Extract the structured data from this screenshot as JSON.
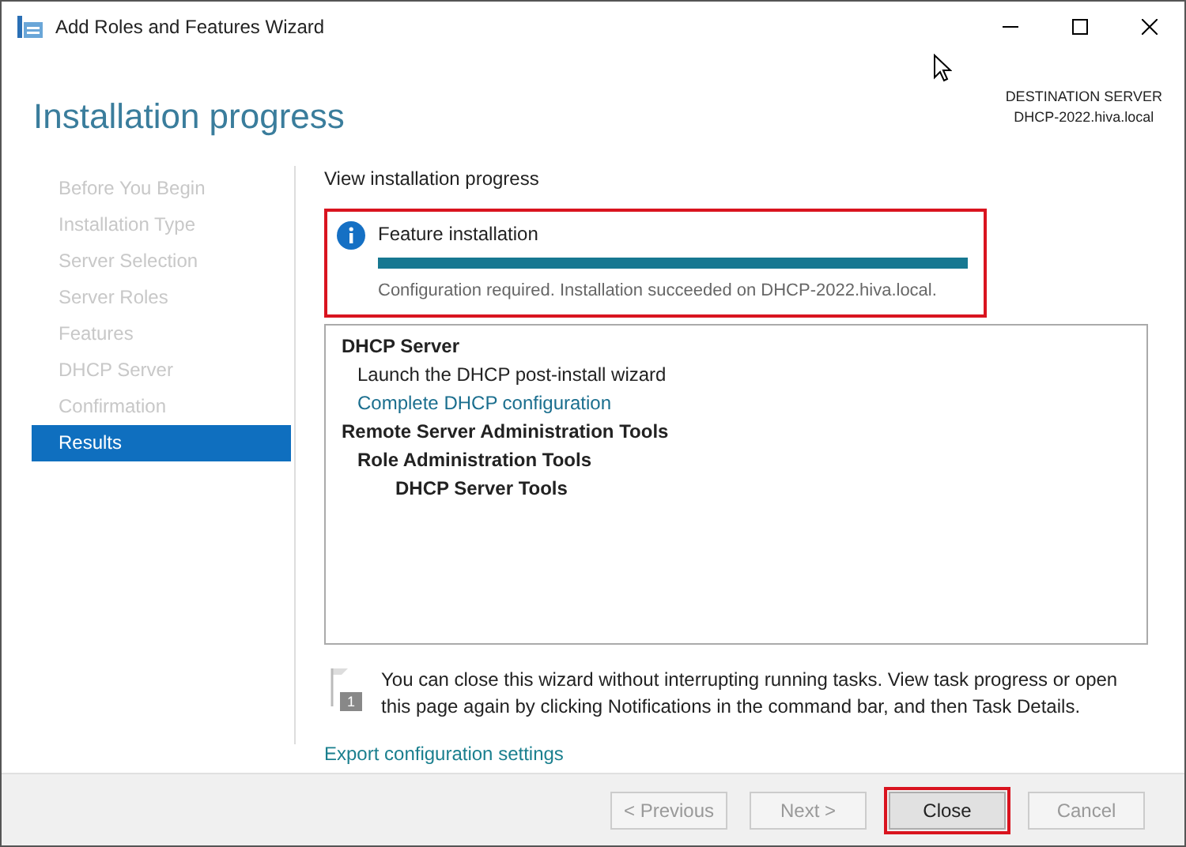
{
  "window": {
    "title": "Add Roles and Features Wizard"
  },
  "header": {
    "title": "Installation progress",
    "destination_label": "DESTINATION SERVER",
    "destination_server": "DHCP-2022.hiva.local"
  },
  "nav": [
    {
      "label": "Before You Begin",
      "selected": false
    },
    {
      "label": "Installation Type",
      "selected": false
    },
    {
      "label": "Server Selection",
      "selected": false
    },
    {
      "label": "Server Roles",
      "selected": false
    },
    {
      "label": "Features",
      "selected": false
    },
    {
      "label": "DHCP Server",
      "selected": false
    },
    {
      "label": "Confirmation",
      "selected": false
    },
    {
      "label": "Results",
      "selected": true
    }
  ],
  "section_title": "View installation progress",
  "progress": {
    "title": "Feature installation",
    "level": 1.0,
    "message": "Configuration required. Installation succeeded on DHCP-2022.hiva.local.",
    "highlighted": true
  },
  "results": [
    {
      "kind": "heading",
      "text": "DHCP Server",
      "children": [
        {
          "kind": "text",
          "text": "Launch the DHCP post-install wizard"
        },
        {
          "kind": "link",
          "text": "Complete DHCP configuration"
        }
      ]
    },
    {
      "kind": "heading",
      "text": "Remote Server Administration Tools",
      "children": [
        {
          "kind": "heading",
          "text": "Role Administration Tools",
          "children": [
            {
              "kind": "heading",
              "text": "DHCP Server Tools"
            }
          ]
        }
      ]
    }
  ],
  "notice": {
    "badge": "1",
    "text": "You can close this wizard without interrupting running tasks. View task progress or open this page again by clicking Notifications in the command bar, and then Task Details."
  },
  "export_link": "Export configuration settings",
  "buttons": [
    {
      "label": "< Previous",
      "disabled": true,
      "highlighted": false
    },
    {
      "label": "Next >",
      "disabled": true,
      "highlighted": false
    },
    {
      "label": "Close",
      "disabled": false,
      "highlighted": true
    },
    {
      "label": "Cancel",
      "disabled": true,
      "highlighted": false
    }
  ]
}
